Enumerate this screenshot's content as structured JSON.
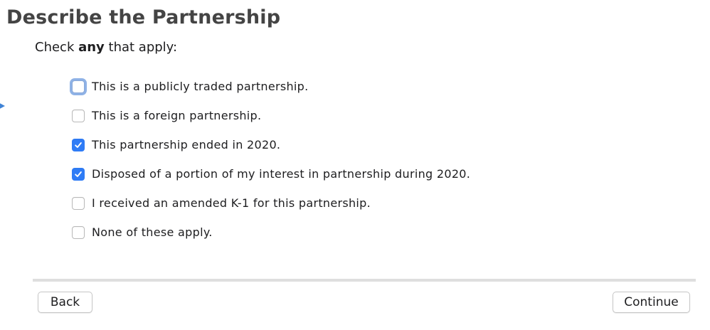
{
  "page": {
    "title": "Describe the Partnership",
    "instruction_prefix": "Check ",
    "instruction_emphasis": "any",
    "instruction_suffix": " that apply:"
  },
  "options": [
    {
      "label": "This is a publicly traded partnership.",
      "checked": false,
      "focused": true
    },
    {
      "label": "This is a foreign partnership.",
      "checked": false,
      "focused": false
    },
    {
      "label": "This partnership ended in 2020.",
      "checked": true,
      "focused": false
    },
    {
      "label": "Disposed of a portion of my interest in partnership during 2020.",
      "checked": true,
      "focused": false
    },
    {
      "label": "I received an amended K-1 for this partnership.",
      "checked": false,
      "focused": false
    },
    {
      "label": "None of these apply.",
      "checked": false,
      "focused": false
    }
  ],
  "footer": {
    "back_label": "Back",
    "continue_label": "Continue"
  },
  "colors": {
    "accent": "#2f7cf6",
    "focus_ring": "#8fb2e6",
    "title": "#444444",
    "divider": "#dedede"
  },
  "icons": {
    "side_marker": "triangle-right-icon",
    "check": "checkmark-icon"
  }
}
